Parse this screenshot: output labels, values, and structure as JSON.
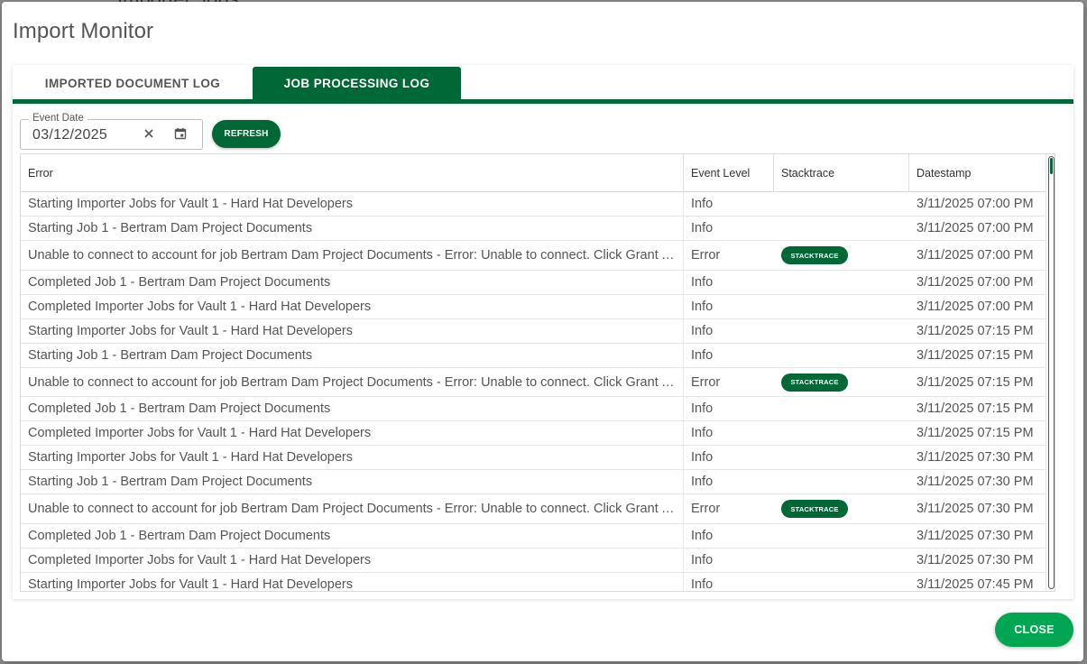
{
  "backdrop": {
    "partial_text": "Importer Jobs"
  },
  "dialog": {
    "title": "Import Monitor"
  },
  "tabs": [
    {
      "label": "IMPORTED DOCUMENT LOG",
      "active": false
    },
    {
      "label": "JOB PROCESSING LOG",
      "active": true
    }
  ],
  "filter": {
    "date_label": "Event Date",
    "date_value": "03/12/2025",
    "clear_icon": "close-icon",
    "calendar_icon": "calendar-icon",
    "refresh_label": "REFRESH"
  },
  "table": {
    "columns": [
      "Error",
      "Event Level",
      "Stacktrace",
      "Datestamp"
    ],
    "stacktrace_label": "STACKTRACE",
    "rows": [
      {
        "error": "Starting Importer Jobs for Vault 1 - Hard Hat Developers",
        "level": "Info",
        "stacktrace": false,
        "datestamp": "3/11/2025 07:00 PM"
      },
      {
        "error": "Starting Job 1 - Bertram Dam Project Documents",
        "level": "Info",
        "stacktrace": false,
        "datestamp": "3/11/2025 07:00 PM"
      },
      {
        "error": "Unable to connect to account for job Bertram Dam Project Documents - Error: Unable to connect. Click Grant Ac…",
        "level": "Error",
        "stacktrace": true,
        "datestamp": "3/11/2025 07:00 PM"
      },
      {
        "error": "Completed Job 1 - Bertram Dam Project Documents",
        "level": "Info",
        "stacktrace": false,
        "datestamp": "3/11/2025 07:00 PM"
      },
      {
        "error": "Completed Importer Jobs for Vault 1 - Hard Hat Developers",
        "level": "Info",
        "stacktrace": false,
        "datestamp": "3/11/2025 07:00 PM"
      },
      {
        "error": "Starting Importer Jobs for Vault 1 - Hard Hat Developers",
        "level": "Info",
        "stacktrace": false,
        "datestamp": "3/11/2025 07:15 PM"
      },
      {
        "error": "Starting Job 1 - Bertram Dam Project Documents",
        "level": "Info",
        "stacktrace": false,
        "datestamp": "3/11/2025 07:15 PM"
      },
      {
        "error": "Unable to connect to account for job Bertram Dam Project Documents - Error: Unable to connect. Click Grant Ac…",
        "level": "Error",
        "stacktrace": true,
        "datestamp": "3/11/2025 07:15 PM"
      },
      {
        "error": "Completed Job 1 - Bertram Dam Project Documents",
        "level": "Info",
        "stacktrace": false,
        "datestamp": "3/11/2025 07:15 PM"
      },
      {
        "error": "Completed Importer Jobs for Vault 1 - Hard Hat Developers",
        "level": "Info",
        "stacktrace": false,
        "datestamp": "3/11/2025 07:15 PM"
      },
      {
        "error": "Starting Importer Jobs for Vault 1 - Hard Hat Developers",
        "level": "Info",
        "stacktrace": false,
        "datestamp": "3/11/2025 07:30 PM"
      },
      {
        "error": "Starting Job 1 - Bertram Dam Project Documents",
        "level": "Info",
        "stacktrace": false,
        "datestamp": "3/11/2025 07:30 PM"
      },
      {
        "error": "Unable to connect to account for job Bertram Dam Project Documents - Error: Unable to connect. Click Grant Ac…",
        "level": "Error",
        "stacktrace": true,
        "datestamp": "3/11/2025 07:30 PM"
      },
      {
        "error": "Completed Job 1 - Bertram Dam Project Documents",
        "level": "Info",
        "stacktrace": false,
        "datestamp": "3/11/2025 07:30 PM"
      },
      {
        "error": "Completed Importer Jobs for Vault 1 - Hard Hat Developers",
        "level": "Info",
        "stacktrace": false,
        "datestamp": "3/11/2025 07:30 PM"
      },
      {
        "error": "Starting Importer Jobs for Vault 1 - Hard Hat Developers",
        "level": "Info",
        "stacktrace": false,
        "datestamp": "3/11/2025 07:45 PM"
      }
    ]
  },
  "footer": {
    "close_label": "CLOSE"
  },
  "colors": {
    "primary": "#006837",
    "accent": "#00a651"
  }
}
